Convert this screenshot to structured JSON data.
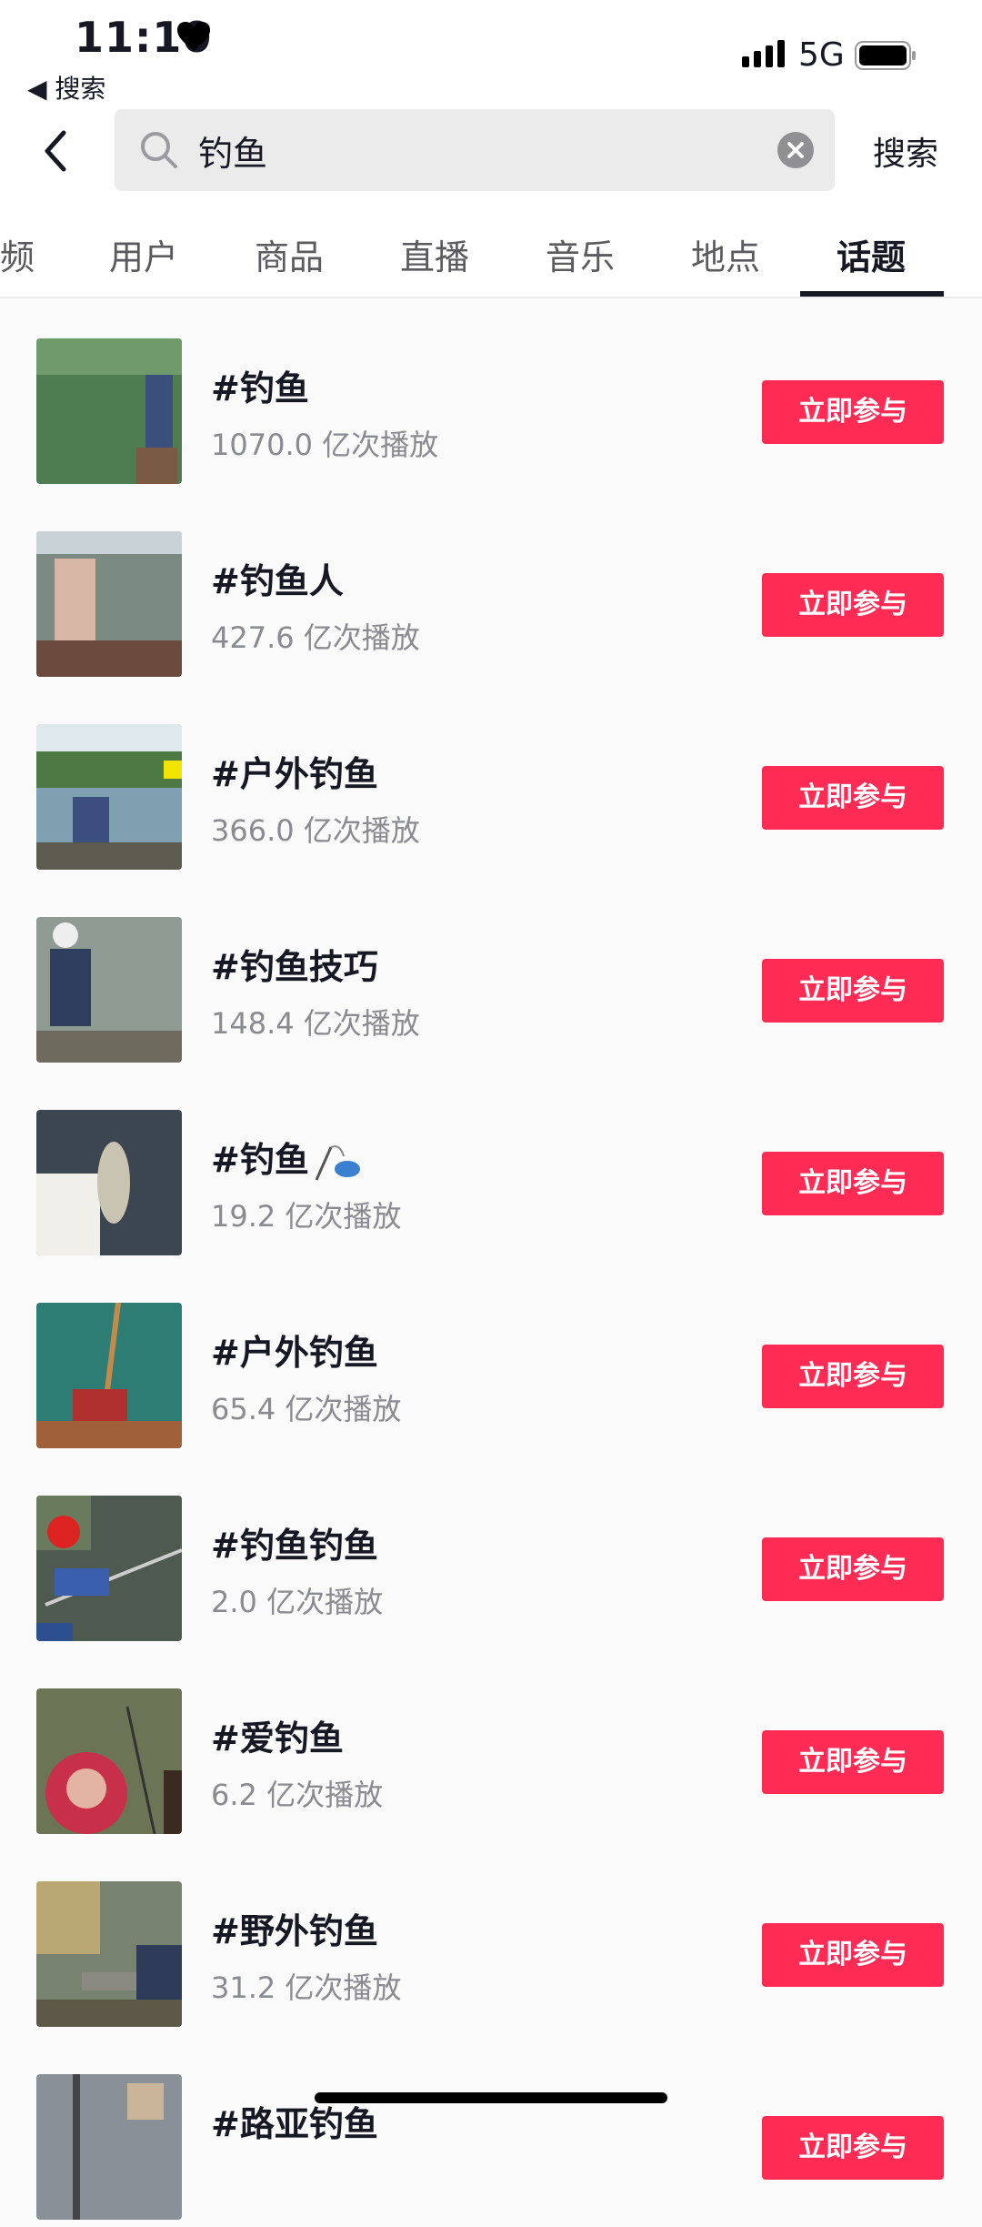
{
  "status_bar": {
    "time": "11:10",
    "back_app": "◀ 搜索",
    "network": "5G"
  },
  "search": {
    "query": "钓鱼",
    "button_label": "搜索"
  },
  "tabs": [
    {
      "label": "频"
    },
    {
      "label": "用户"
    },
    {
      "label": "商品"
    },
    {
      "label": "直播"
    },
    {
      "label": "音乐"
    },
    {
      "label": "地点"
    },
    {
      "label": "话题",
      "active": true
    }
  ],
  "topics": [
    {
      "title": "#钓鱼",
      "plays": "1070.0 亿次播放",
      "button": "立即参与"
    },
    {
      "title": "#钓鱼人",
      "plays": "427.6 亿次播放",
      "button": "立即参与"
    },
    {
      "title": "#户外钓鱼",
      "plays": "366.0 亿次播放",
      "button": "立即参与"
    },
    {
      "title": "#钓鱼技巧",
      "plays": "148.4 亿次播放",
      "button": "立即参与"
    },
    {
      "title": "#钓鱼",
      "plays": "19.2 亿次播放",
      "button": "立即参与"
    },
    {
      "title": "#户外钓鱼",
      "plays": "65.4 亿次播放",
      "button": "立即参与"
    },
    {
      "title": "#钓鱼钓鱼",
      "plays": "2.0 亿次播放",
      "button": "立即参与"
    },
    {
      "title": "#爱钓鱼",
      "plays": "6.2 亿次播放",
      "button": "立即参与"
    },
    {
      "title": "#野外钓鱼",
      "plays": "31.2 亿次播放",
      "button": "立即参与"
    },
    {
      "title": "#路亚钓鱼",
      "plays": "",
      "button": "立即参与"
    }
  ],
  "colors": {
    "accent": "#fe2c55",
    "text": "#161823",
    "secondary_text": "#8a8b91"
  }
}
